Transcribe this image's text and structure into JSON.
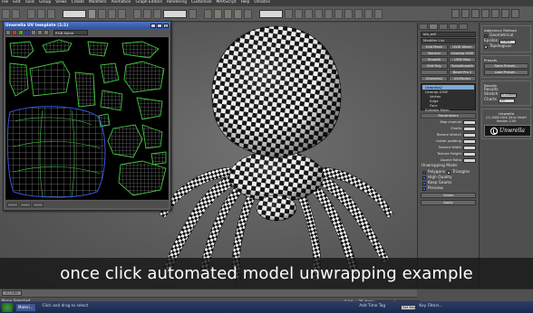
{
  "menubar": {
    "items": [
      "File",
      "Edit",
      "Tools",
      "Group",
      "Views",
      "Create",
      "Modifiers",
      "Animation",
      "Graph Editors",
      "Rendering",
      "Customize",
      "MAXScript",
      "Help",
      "Ornatrix"
    ]
  },
  "uv_window": {
    "title": "Unwrella UV template (1:1)",
    "channel_dropdown": "RGB Alpha",
    "close_glyph": "x",
    "uv_line_color": "#3fc83f",
    "uv_boundary_color": "#3355dd"
  },
  "command_panel": {
    "object_name": "blb_adf",
    "modifier_list": "Modifier List",
    "buttons": [
      [
        "Edit Mesh",
        "UVW Xform"
      ],
      [
        "Normal",
        "Unwrap UVW"
      ],
      [
        "Smooth",
        "UVW Map"
      ],
      [
        "Edit Poly",
        "TurboSmooth"
      ],
      [
        "",
        "Bevel Pro 2"
      ],
      [
        "Unwrella2",
        "UV-Packer"
      ]
    ],
    "stack": [
      {
        "label": "Unwrella2",
        "highlight": true,
        "sub": false
      },
      {
        "label": "Unwrap UVW",
        "highlight": false,
        "sub": false
      },
      {
        "label": "Vertex",
        "highlight": false,
        "sub": true
      },
      {
        "label": "Edge",
        "highlight": false,
        "sub": true
      },
      {
        "label": "Face",
        "highlight": false,
        "sub": true
      },
      {
        "label": "Editable Mesh",
        "highlight": false,
        "sub": false
      }
    ],
    "parameters_title": "Parameters",
    "params": [
      "Map channel",
      "Charts",
      "Texture stretch",
      "Gutter padding",
      "Texture Width",
      "Texture Height",
      "Aspect Ratio"
    ],
    "unwrapping_mode": "Unwrapping Mode:",
    "mode_polygons": "Polygons",
    "mode_triangles": "Triangles",
    "checks": [
      {
        "label": "High Quality",
        "on": true
      },
      {
        "label": "Keep Seams",
        "on": true
      },
      {
        "label": "Preview",
        "on": true
      }
    ],
    "colors_label": "Colors",
    "apply_button": "Apply"
  },
  "side_panel": {
    "adjacency_title": "Adjacency Method",
    "geometrical": "Geometrical",
    "epsilon_label": "Epsilon",
    "epsilon_value": "0.001",
    "topological": "Topological",
    "presets_title": "Presets",
    "save_preset": "Save Preset...",
    "load_preset": "Load Preset...",
    "results_title": "Results",
    "results_label": "Results",
    "stretch_label": "Stretch",
    "stretch_value": "0.128092",
    "charts_label": "Charts",
    "charts_value": "13",
    "unwrella_title": "Unwrella",
    "copyright_line": "(C) 2006-2010 3d-io GmbH",
    "version_line": "Version 2.00",
    "logo_text": "Unwrella"
  },
  "caption": "once click automated model unwrapping example",
  "status": {
    "frame_label": "0 / 100",
    "selection": "None Selected",
    "prompt": "Click and drag to select",
    "grid": "Grid = 25.4cm",
    "auto_key": "Auto Key",
    "selected": "Selected",
    "set_key": "Set Key",
    "key_filters": "Key Filters...",
    "add_time_tag": "Add Time Tag"
  },
  "taskbar": {
    "start_label": "",
    "item": "Materi..."
  },
  "viewport": {
    "label": "[ Perspective ]"
  }
}
